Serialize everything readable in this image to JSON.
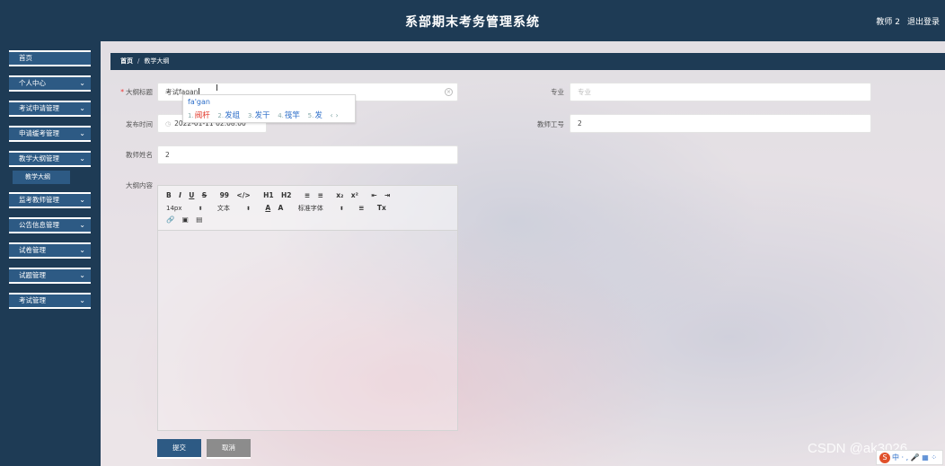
{
  "header": {
    "title": "系部期末考务管理系统",
    "user": "教师 2",
    "logout": "退出登录"
  },
  "sidebar": {
    "items": [
      {
        "label": "首页",
        "chevron": ""
      },
      {
        "label": "个人中心",
        "chevron": "⌄"
      },
      {
        "label": "考试申请管理",
        "chevron": "⌄"
      },
      {
        "label": "申请缓考管理",
        "chevron": "⌄"
      },
      {
        "label": "教学大纲管理",
        "chevron": "⌄"
      },
      {
        "label": "监考教师管理",
        "chevron": "⌄"
      },
      {
        "label": "公告信息管理",
        "chevron": "⌄"
      },
      {
        "label": "试卷管理",
        "chevron": "⌄"
      },
      {
        "label": "试题管理",
        "chevron": "⌄"
      },
      {
        "label": "考试管理",
        "chevron": "⌄"
      }
    ],
    "sub_item": "教学大纲"
  },
  "breadcrumb": {
    "home": "首页",
    "sep": "/",
    "current": "教学大纲"
  },
  "form": {
    "title_label": "大纲标题",
    "title_value": "考试fagan",
    "major_label": "专业",
    "major_placeholder": "专业",
    "date_label": "发布时间",
    "date_value": "2022-01-11 02:08:00",
    "teacher_no_label": "教师工号",
    "teacher_no_value": "2",
    "teacher_name_label": "教师姓名",
    "teacher_name_value": "2",
    "content_label": "大纲内容"
  },
  "ime": {
    "pinyin": "fa'gan",
    "candidates": [
      {
        "num": "1.",
        "text": "阀杆"
      },
      {
        "num": "2.",
        "text": "发组"
      },
      {
        "num": "3.",
        "text": "发干"
      },
      {
        "num": "4.",
        "text": "筏竿"
      },
      {
        "num": "5.",
        "text": "发"
      }
    ],
    "prev": "‹",
    "next": "›"
  },
  "editor": {
    "row1": [
      "B",
      "I",
      "U",
      "S",
      "99",
      "</>",
      "H1",
      "H2",
      "≡",
      "≡",
      "x₂",
      "x²",
      "⇤",
      "⇥"
    ],
    "row2": {
      "size": "14px",
      "type": "文本",
      "color": "A",
      "bg": "A",
      "font": "标准字体",
      "align": "≡",
      "clear": "Tx"
    },
    "row3": [
      "🔗",
      "▣",
      "▤"
    ]
  },
  "buttons": {
    "submit": "提交",
    "cancel": "取消"
  },
  "watermark": "CSDN @ak3026",
  "tray": {
    "logo": "S",
    "text": "中 · , 🎤 ▦ ⁘"
  }
}
